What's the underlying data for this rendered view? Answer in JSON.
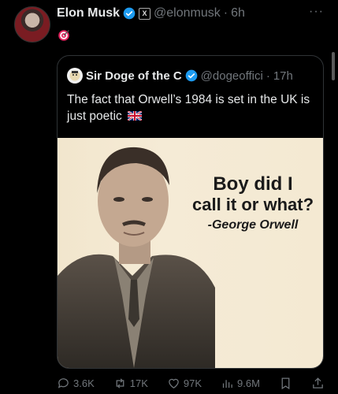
{
  "post": {
    "author_name": "Elon Musk",
    "x_badge": "X",
    "handle": "@elonmusk",
    "separator": "·",
    "time": "6h",
    "more": "···"
  },
  "quoted": {
    "author_name": "Sir Doge of the C",
    "handle": "@dogeoffici",
    "separator": "·",
    "time": "17h",
    "text": "The fact that Orwell’s 1984 is set in the UK is just poetic"
  },
  "meme": {
    "line1": "Boy did I",
    "line2": "call it or what?",
    "line3": "-George Orwell"
  },
  "actions": {
    "replies": "3.6K",
    "reposts": "17K",
    "likes": "97K",
    "views": "9.6M"
  },
  "colors": {
    "verified": "#1d9bf0",
    "muted": "#71767b",
    "target": "#e0245e"
  }
}
